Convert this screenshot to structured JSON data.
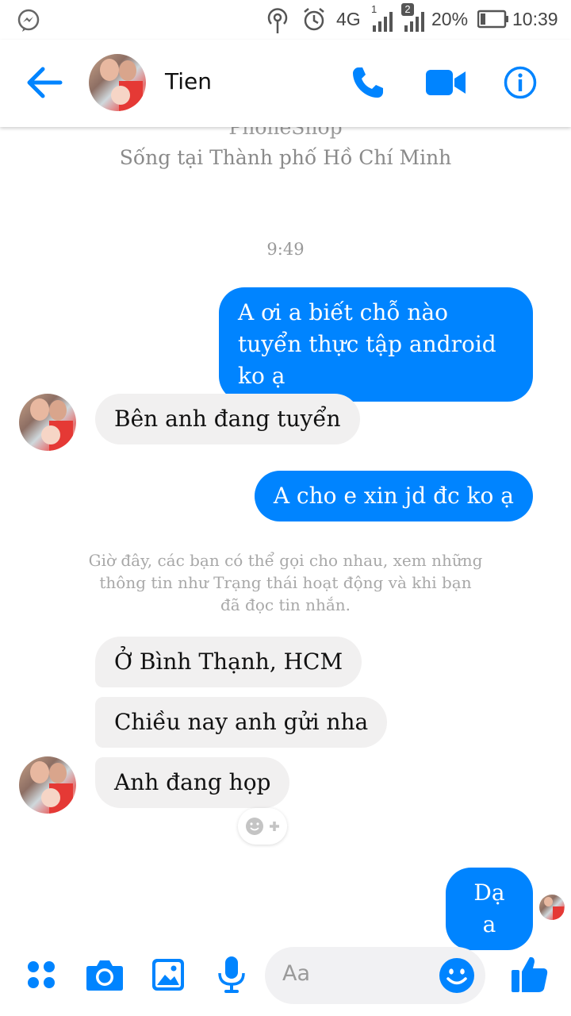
{
  "status_bar": {
    "network": "4G",
    "sim1": "1",
    "sim2": "2",
    "battery": "20%",
    "time": "10:39"
  },
  "header": {
    "contact_name": "Tien",
    "back_icon": "arrow-left-icon",
    "call_icon": "phone-icon",
    "video_icon": "video-camera-icon",
    "info_icon": "info-icon"
  },
  "profile": {
    "workplace": "PhoneShop",
    "location": "Sống tại Thành phố Hồ Chí Minh"
  },
  "conversation": {
    "timestamp": "9:49",
    "msg1_out": "A ơi a biết chỗ nào tuyển thực tập android ko ạ",
    "msg2_in": "Bên anh đang tuyển",
    "msg3_out": "A cho e xin jd đc ko ạ",
    "system_notice": "Giờ đây, các bạn có thể gọi cho nhau, xem những thông tin như Trạng thái hoạt động và khi bạn đã đọc tin nhắn.",
    "msg4_in": "Ở Bình Thạnh, HCM",
    "msg5_in": "Chiều nay anh gửi nha",
    "msg6_in": "Anh đang họp",
    "msg7_out": "Dạ a"
  },
  "composer": {
    "placeholder": "Aa",
    "icons": [
      "grid-icon",
      "camera-icon",
      "image-icon",
      "microphone-icon",
      "emoji-icon",
      "thumbs-up-icon"
    ]
  },
  "colors": {
    "accent": "#0084ff",
    "incoming_bubble": "#f1f0f0",
    "muted_text": "#9a9a9a"
  }
}
